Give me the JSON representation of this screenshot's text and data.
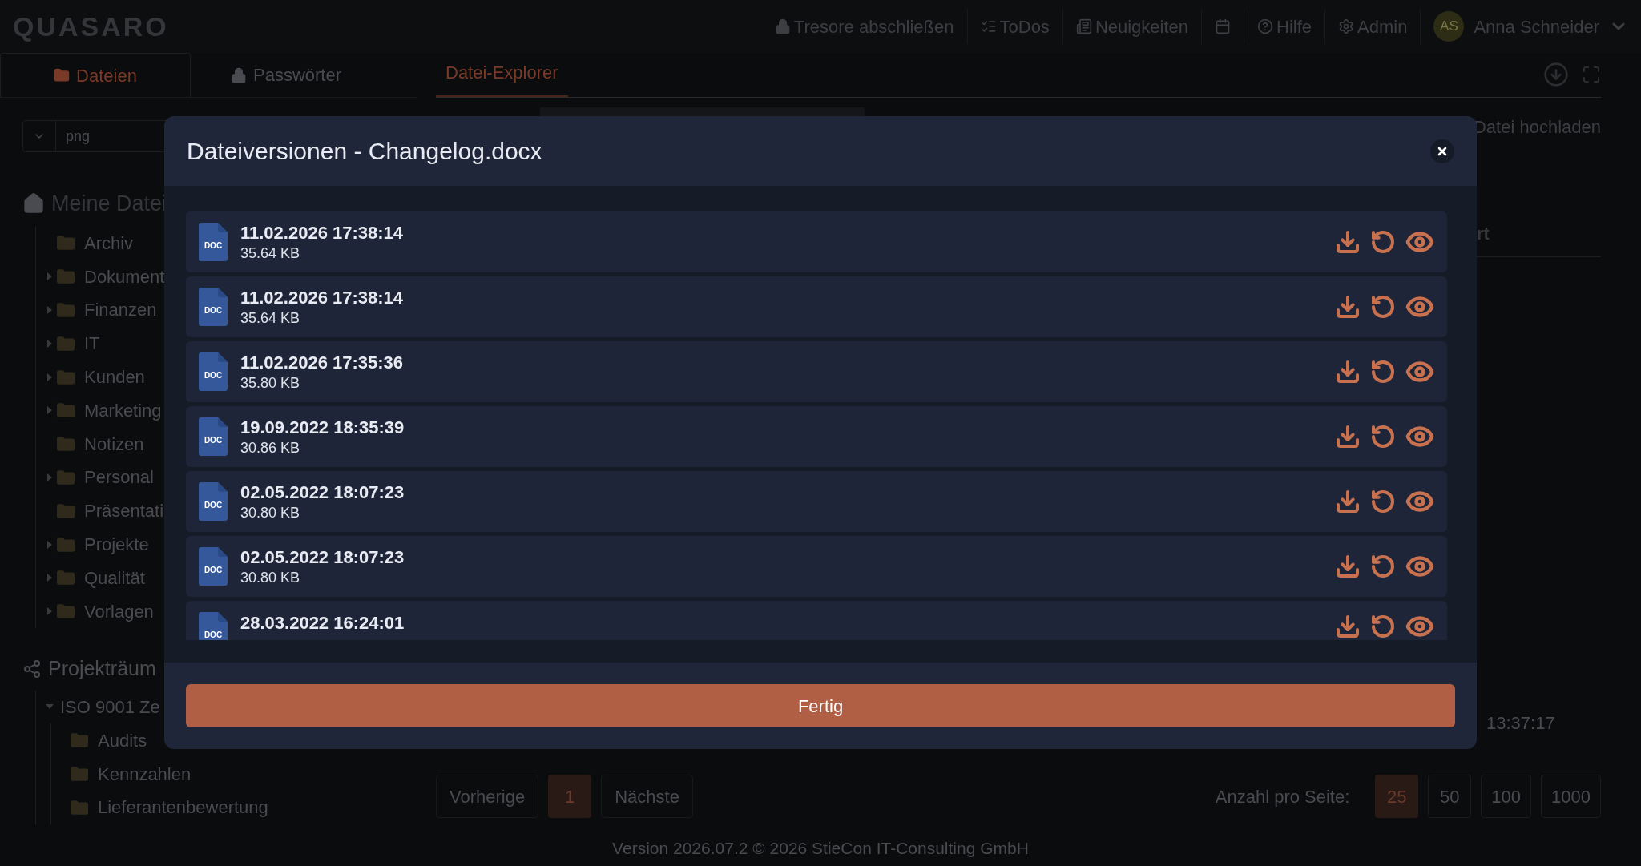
{
  "header": {
    "logo": "QUASARO",
    "nav": [
      {
        "kind": "lock",
        "label": "Tresore abschließen"
      },
      {
        "kind": "todo",
        "label": "ToDos"
      },
      {
        "kind": "news",
        "label": "Neuigkeiten"
      },
      {
        "kind": "calendar"
      },
      {
        "kind": "help",
        "label": "Hilfe"
      },
      {
        "kind": "gear",
        "label": "Admin"
      }
    ],
    "user": {
      "initials": "AS",
      "name": "Anna Schneider"
    }
  },
  "sidebar": {
    "tabs": [
      {
        "kind": "folder",
        "label": "Dateien",
        "selected": true
      },
      {
        "kind": "lock",
        "label": "Passwörter",
        "selected": false
      }
    ],
    "filter": {
      "value": "png"
    },
    "my_files": {
      "title": "Meine Datei",
      "items": [
        {
          "label": "Archiv",
          "expandable": false
        },
        {
          "label": "Dokument",
          "expandable": true
        },
        {
          "label": "Finanzen",
          "expandable": true
        },
        {
          "label": "IT",
          "expandable": true
        },
        {
          "label": "Kunden",
          "expandable": true
        },
        {
          "label": "Marketing",
          "expandable": true
        },
        {
          "label": "Notizen",
          "expandable": false
        },
        {
          "label": "Personal",
          "expandable": true
        },
        {
          "label": "Präsentati",
          "expandable": false
        },
        {
          "label": "Projekte",
          "expandable": true
        },
        {
          "label": "Qualität",
          "expandable": true
        },
        {
          "label": "Vorlagen",
          "expandable": true
        }
      ]
    },
    "project_rooms": {
      "title": "Projekträum",
      "items": [
        {
          "label": "ISO 9001 Ze",
          "expanded": true,
          "children": [
            {
              "label": "Audits"
            },
            {
              "label": "Kennzahlen"
            },
            {
              "label": "Lieferantenbewertung"
            }
          ]
        }
      ]
    }
  },
  "main": {
    "tabs": [
      {
        "label": "Datei-Explorer",
        "selected": true
      }
    ],
    "upload_button": "Datei hochladen",
    "column_header": "rt",
    "cell": "13:37:17",
    "pagination": {
      "previous": "Vorherige",
      "pages": [
        {
          "label": "1",
          "selected": true
        }
      ],
      "next": "Nächste"
    },
    "page_size": {
      "label": "Anzahl pro Seite:",
      "options": [
        {
          "label": "25",
          "selected": true
        },
        {
          "label": "50",
          "selected": false
        },
        {
          "label": "100",
          "selected": false
        },
        {
          "label": "1000",
          "selected": false
        }
      ]
    }
  },
  "footer": "Version 2026.07.2 © 2026 StieCon IT-Consulting GmbH",
  "modal": {
    "title": "Dateiversionen - Changelog.docx",
    "versions": [
      {
        "file_type": "DOC",
        "date": "11.02.2026 17:38:14",
        "size": "35.64 KB"
      },
      {
        "file_type": "DOC",
        "date": "11.02.2026 17:38:14",
        "size": "35.64 KB"
      },
      {
        "file_type": "DOC",
        "date": "11.02.2026 17:35:36",
        "size": "35.80 KB"
      },
      {
        "file_type": "DOC",
        "date": "19.09.2022 18:35:39",
        "size": "30.86 KB"
      },
      {
        "file_type": "DOC",
        "date": "02.05.2022 18:07:23",
        "size": "30.80 KB"
      },
      {
        "file_type": "DOC",
        "date": "02.05.2022 18:07:23",
        "size": "30.80 KB"
      },
      {
        "file_type": "DOC",
        "date": "28.03.2022 16:24:01"
      }
    ],
    "button": "Fertig"
  }
}
